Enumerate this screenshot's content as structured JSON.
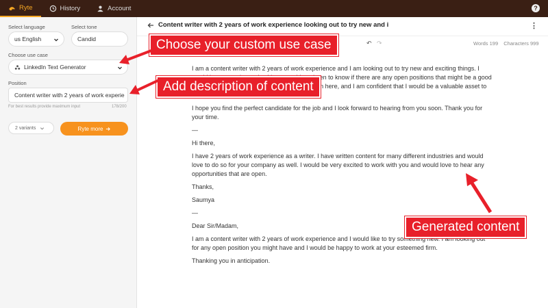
{
  "topbar": {
    "tabs": [
      {
        "label": "Ryte",
        "icon": "ryte-logo-icon"
      },
      {
        "label": "History",
        "icon": "clock-icon"
      },
      {
        "label": "Account",
        "icon": "user-icon"
      }
    ],
    "help": "?"
  },
  "sidebar": {
    "language_label": "Select language",
    "language_value": "us English",
    "tone_label": "Select tone",
    "tone_value": "Candid",
    "usecase_label": "Choose use case",
    "usecase_value": "LinkedIn Text Generator",
    "position_label": "Position",
    "position_value": "Content writer with 2 years of work experie",
    "hint": "For best results provide maximum input",
    "counter": "178/200",
    "variants": "2 variants",
    "ryte_button": "Ryte more"
  },
  "editor": {
    "title": "Content writer with 2 years of work experience looking out to try new and i",
    "toolbar_b": "B",
    "words": "Words 199",
    "characters": "Characters 999"
  },
  "content": {
    "p1": "I am a content writer with 2 years of work experience and I am looking out to try new and exciting things. I would love to get in touch with you and I am keen to know if there are any open positions that might be a good fit. I would love to be considered for any position here, and I am confident that I would be a valuable asset to your team.",
    "p2": "I hope you find the perfect candidate for the job and I look forward to hearing from you soon. Thank you for your time.",
    "sep1": "—",
    "p3": "Hi there,",
    "p4": "I have 2 years of work experience as a writer. I have written content for many different industries and would love to do so for your company as well. I would be very excited to work with you and would love to hear any opportunities that are open.",
    "p5": "Thanks,",
    "p6": "Saumya",
    "sep2": "—",
    "p7": "Dear Sir/Madam,",
    "p8": "I am a content writer with 2 years of work experience and I would like to try something new. I am looking out for any open position you might have and I would be happy to work at your esteemed firm.",
    "p9": "Thanking you in anticipation."
  },
  "annotations": {
    "usecase": "Choose your custom use case",
    "description": "Add description of content",
    "generated": "Generated content"
  },
  "colors": {
    "topbar": "#3a1f14",
    "accent": "#f7921e",
    "annotation": "#e8202a"
  }
}
